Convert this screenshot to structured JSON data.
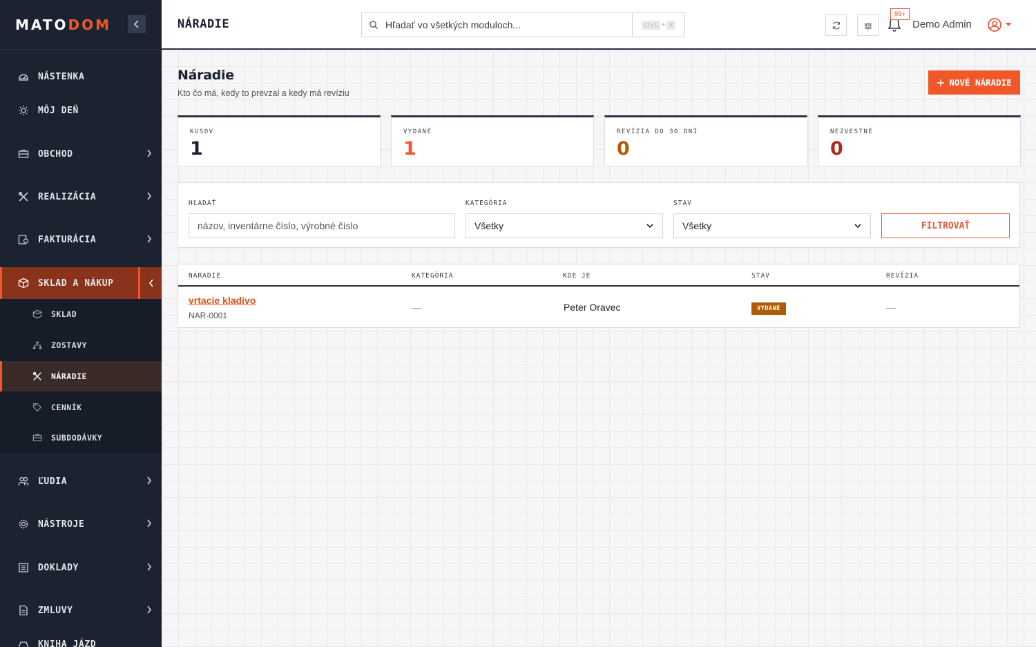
{
  "brand": {
    "logo_main": "MATO",
    "logo_accent": "DOM"
  },
  "sidebar": {
    "items": [
      {
        "label": "NÁSTENKA",
        "icon": "dashboard-icon"
      },
      {
        "label": "MÔJ DEŇ",
        "icon": "sun-icon"
      },
      {
        "label": "OBCHOD",
        "icon": "briefcase-icon"
      },
      {
        "label": "REALIZÁCIA",
        "icon": "tools-icon"
      },
      {
        "label": "FAKTURÁCIA",
        "icon": "invoice-icon"
      },
      {
        "label": "SKLAD A NÁKUP",
        "icon": "box-icon"
      },
      {
        "label": "ĽUDIA",
        "icon": "users-icon"
      },
      {
        "label": "NÁSTROJE",
        "icon": "gear-icon"
      },
      {
        "label": "DOKLADY",
        "icon": "document-icon"
      },
      {
        "label": "ZMLUVY",
        "icon": "contract-icon"
      },
      {
        "label": "KNIHA JÁZD",
        "icon": "car-icon"
      }
    ],
    "submenu": [
      {
        "label": "SKLAD",
        "icon": "box-icon"
      },
      {
        "label": "ZOSTAVY",
        "icon": "hierarchy-icon"
      },
      {
        "label": "NÁRADIE",
        "icon": "tools-icon"
      },
      {
        "label": "CENNÍK",
        "icon": "tag-icon"
      },
      {
        "label": "SUBDODÁVKY",
        "icon": "briefcase-icon"
      }
    ]
  },
  "topbar": {
    "heading": "NÁRADIE",
    "search_placeholder": "Hľadať vo všetkých moduloch...",
    "shortcut_ctrl": "Ctrl",
    "shortcut_plus": "+",
    "shortcut_key": "K",
    "notifications": "99+",
    "user_name": "Demo Admin"
  },
  "page": {
    "title": "Náradie",
    "subtitle": "Kto čo má, kedy to prevzal a kedy má revíziu",
    "new_button": "NOVÉ NÁRADIE"
  },
  "stats": [
    {
      "label": "KUSOV",
      "value": "1",
      "color": "#1b2230"
    },
    {
      "label": "VYDANÉ",
      "value": "1",
      "color": "#f0582a"
    },
    {
      "label": "REVÍZIA DO 30 DNÍ",
      "value": "0",
      "color": "#b05c06"
    },
    {
      "label": "NEZVESTNÉ",
      "value": "0",
      "color": "#b3261e"
    }
  ],
  "filters": {
    "search_label": "HĽADAŤ",
    "search_placeholder": "názov, inventárne číslo, výrobné číslo",
    "category_label": "KATEGÓRIA",
    "category_value": "Všetky",
    "status_label": "STAV",
    "status_value": "Všetky",
    "filter_button": "FILTROVAŤ"
  },
  "table": {
    "headers": [
      "NÁRADIE",
      "KATEGÓRIA",
      "KDE JE",
      "STAV",
      "REVÍZIA"
    ],
    "rows": [
      {
        "name": "vrtacie kladivo",
        "code": "NAR-0001",
        "category": "—",
        "location": "Peter Oravec",
        "status": "VYDANÉ",
        "revision": "—"
      }
    ]
  },
  "colors": {
    "accent": "#f0582a",
    "sidebar": "#1b2230",
    "status_issued": "#b05c06"
  }
}
